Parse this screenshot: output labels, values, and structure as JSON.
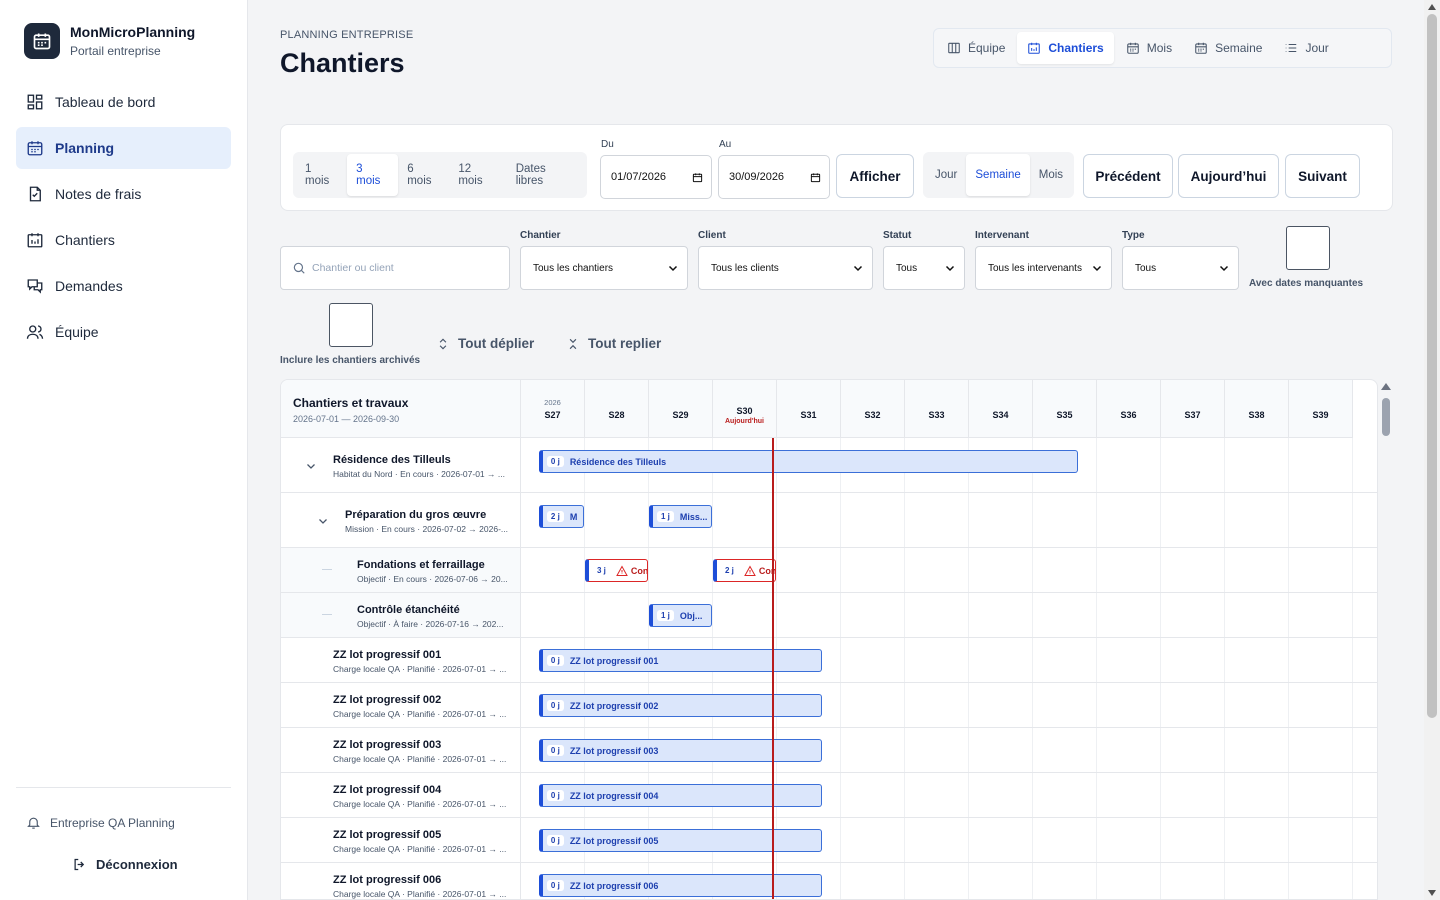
{
  "brand": {
    "name": "MonMicroPlanning",
    "subtitle": "Portail entreprise"
  },
  "nav": [
    {
      "label": "Tableau de bord",
      "icon": "dashboard-icon",
      "active": false
    },
    {
      "label": "Planning",
      "icon": "calendar-icon",
      "active": true
    },
    {
      "label": "Notes de frais",
      "icon": "receipt-icon",
      "active": false
    },
    {
      "label": "Chantiers",
      "icon": "chart-icon",
      "active": false
    },
    {
      "label": "Demandes",
      "icon": "chat-icon",
      "active": false
    },
    {
      "label": "Équipe",
      "icon": "users-icon",
      "active": false
    }
  ],
  "footer": {
    "company": "Entreprise QA Planning",
    "logout": "Déconnexion"
  },
  "header": {
    "breadcrumb": "PLANNING ENTREPRISE",
    "title": "Chantiers"
  },
  "views": [
    {
      "label": "Équipe",
      "icon": "columns-icon",
      "active": false
    },
    {
      "label": "Chantiers",
      "icon": "chart-icon",
      "active": true
    },
    {
      "label": "Mois",
      "icon": "calendar-icon",
      "active": false
    },
    {
      "label": "Semaine",
      "icon": "calendar-icon",
      "active": false
    },
    {
      "label": "Jour",
      "icon": "list-icon",
      "active": false
    }
  ],
  "toolbar": {
    "ranges": [
      {
        "label": "1 mois",
        "active": false
      },
      {
        "label": "3 mois",
        "active": true
      },
      {
        "label": "6 mois",
        "active": false
      },
      {
        "label": "12 mois",
        "active": false
      },
      {
        "label": "Dates libres",
        "active": false
      }
    ],
    "from_label": "Du",
    "from_value": "01/07/2026",
    "to_label": "Au",
    "to_value": "30/09/2026",
    "show": "Afficher",
    "granularity": [
      {
        "label": "Jour",
        "active": false
      },
      {
        "label": "Semaine",
        "active": true
      },
      {
        "label": "Mois",
        "active": false
      }
    ],
    "prev": "Précédent",
    "today": "Aujourd’hui",
    "next": "Suivant"
  },
  "filters": {
    "search_placeholder": "Chantier ou client",
    "chantier_label": "Chantier",
    "chantier_value": "Tous les chantiers",
    "client_label": "Client",
    "client_value": "Tous les clients",
    "statut_label": "Statut",
    "statut_value": "Tous",
    "intervenant_label": "Intervenant",
    "intervenant_value": "Tous les intervenants",
    "type_label": "Type",
    "type_value": "Tous",
    "missing_dates": "Avec dates manquantes",
    "archived": "Inclure les chantiers archivés",
    "expand_all": "Tout déplier",
    "collapse_all": "Tout replier"
  },
  "gantt": {
    "title": "Chantiers et travaux",
    "range": "2026-07-01 — 2026-09-30",
    "year": "2026",
    "today_label": "Aujourd'hui",
    "today_week": 3,
    "weeks": [
      "S27",
      "S28",
      "S29",
      "S30",
      "S31",
      "S32",
      "S33",
      "S34",
      "S35",
      "S36",
      "S37",
      "S38",
      "S39"
    ],
    "rows": [
      {
        "name": "Résidence des Tilleuls",
        "meta": "Habitat du Nord · En cours · 2026-07-01 → ...",
        "level": 0,
        "expand": true,
        "bars": [
          {
            "start": 0.28,
            "span": 8.44,
            "days": "0 j",
            "label": "Résidence des Tilleuls",
            "warn": false
          }
        ]
      },
      {
        "name": "Préparation du gros œuvre",
        "meta": "Mission · En cours · 2026-07-02 → 2026-...",
        "level": 1,
        "expand": true,
        "bars": [
          {
            "start": 0.28,
            "span": 0.72,
            "days": "2 j",
            "label": "M",
            "warn": false
          },
          {
            "start": 2.0,
            "span": 1.0,
            "days": "1 j",
            "label": "Miss...",
            "warn": false
          }
        ]
      },
      {
        "name": "Fondations et ferraillage",
        "meta": "Objectif · En cours · 2026-07-06 → 20...",
        "level": 2,
        "expand": false,
        "bars": [
          {
            "start": 1.0,
            "span": 1.0,
            "days": "3 j",
            "label": "Con",
            "warn": true
          },
          {
            "start": 3.0,
            "span": 1.0,
            "days": "2 j",
            "label": "Con",
            "warn": true
          }
        ]
      },
      {
        "name": "Contrôle étanchéité",
        "meta": "Objectif · À faire · 2026-07-16 → 202...",
        "level": 2,
        "expand": false,
        "bars": [
          {
            "start": 2.0,
            "span": 1.0,
            "days": "1 j",
            "label": "Obj...",
            "warn": false
          }
        ]
      },
      {
        "name": "ZZ lot progressif 001",
        "meta": "Charge locale QA · Planifié · 2026-07-01 → ...",
        "level": 0,
        "expand": false,
        "bars": [
          {
            "start": 0.28,
            "span": 4.44,
            "days": "0 j",
            "label": "ZZ lot progressif 001",
            "warn": false
          }
        ]
      },
      {
        "name": "ZZ lot progressif 002",
        "meta": "Charge locale QA · Planifié · 2026-07-01 → ...",
        "level": 0,
        "expand": false,
        "bars": [
          {
            "start": 0.28,
            "span": 4.44,
            "days": "0 j",
            "label": "ZZ lot progressif 002",
            "warn": false
          }
        ]
      },
      {
        "name": "ZZ lot progressif 003",
        "meta": "Charge locale QA · Planifié · 2026-07-01 → ...",
        "level": 0,
        "expand": false,
        "bars": [
          {
            "start": 0.28,
            "span": 4.44,
            "days": "0 j",
            "label": "ZZ lot progressif 003",
            "warn": false
          }
        ]
      },
      {
        "name": "ZZ lot progressif 004",
        "meta": "Charge locale QA · Planifié · 2026-07-01 → ...",
        "level": 0,
        "expand": false,
        "bars": [
          {
            "start": 0.28,
            "span": 4.44,
            "days": "0 j",
            "label": "ZZ lot progressif 004",
            "warn": false
          }
        ]
      },
      {
        "name": "ZZ lot progressif 005",
        "meta": "Charge locale QA · Planifié · 2026-07-01 → ...",
        "level": 0,
        "expand": false,
        "bars": [
          {
            "start": 0.28,
            "span": 4.44,
            "days": "0 j",
            "label": "ZZ lot progressif 005",
            "warn": false
          }
        ]
      },
      {
        "name": "ZZ lot progressif 006",
        "meta": "Charge locale QA · Planifié · 2026-07-01 → ...",
        "level": 0,
        "expand": false,
        "bars": [
          {
            "start": 0.28,
            "span": 4.44,
            "days": "0 j",
            "label": "ZZ lot progressif 006",
            "warn": false
          }
        ]
      }
    ]
  },
  "colors": {
    "accent": "#1d4ed8",
    "active_bg": "#e6effc",
    "today": "#b91c1c",
    "bar_fill": "#dbe6fb"
  }
}
